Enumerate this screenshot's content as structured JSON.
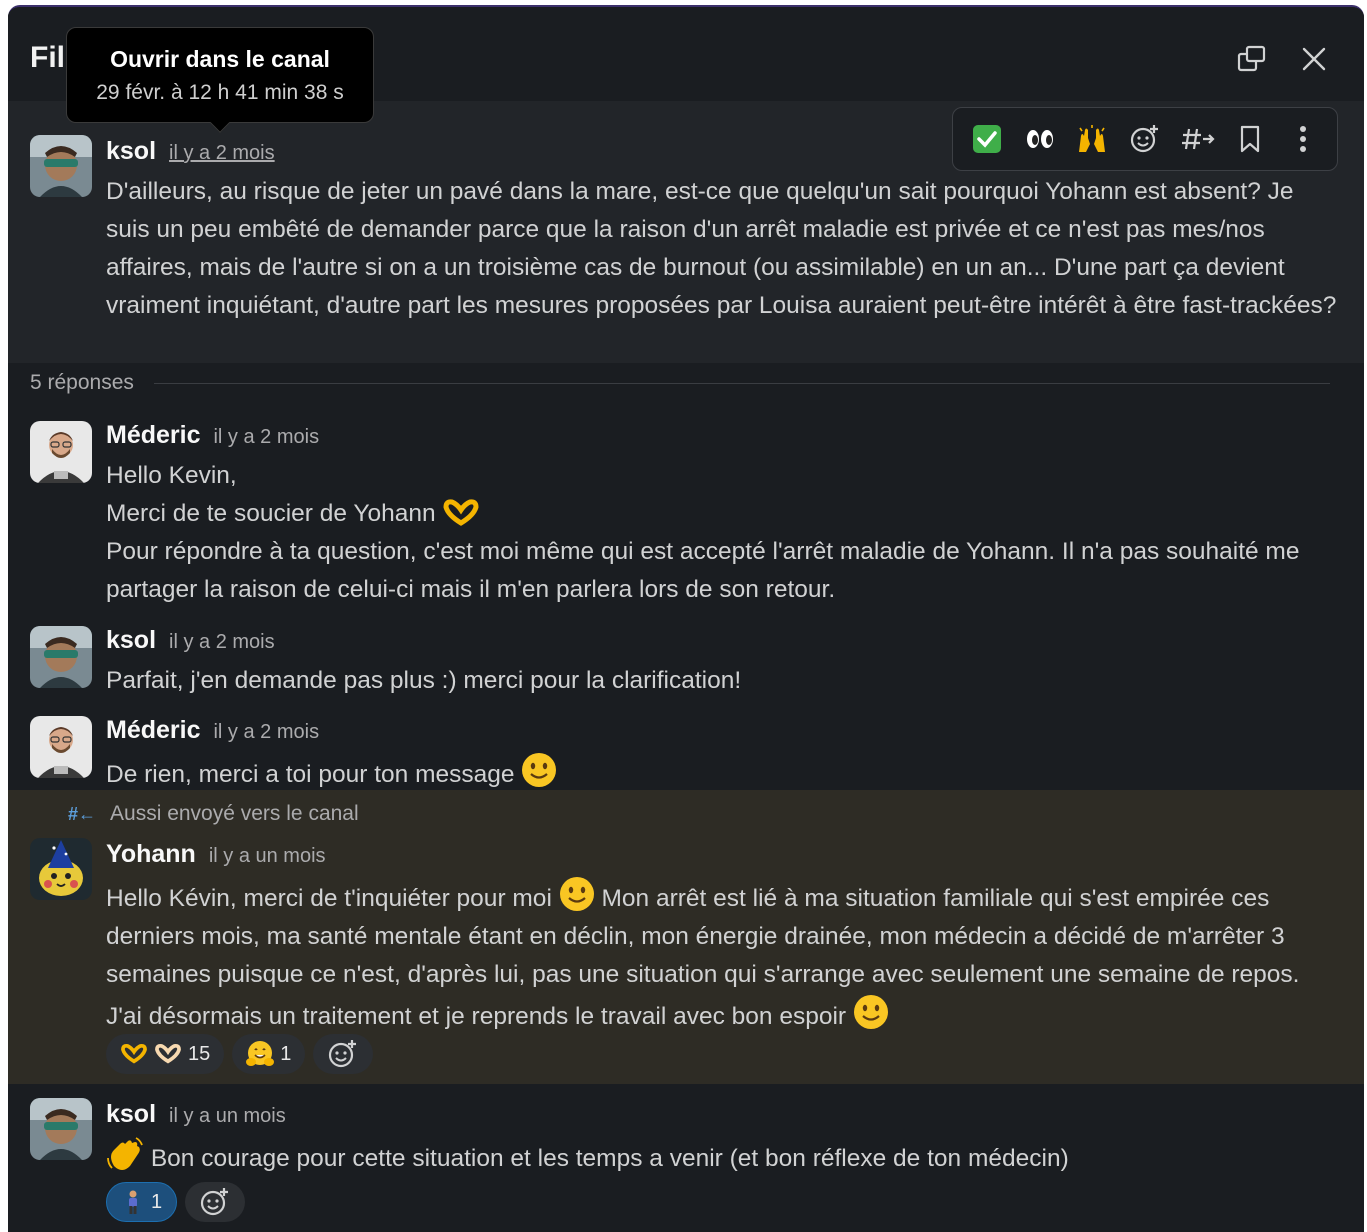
{
  "header": {
    "title": "Fil",
    "tooltip_title": "Ouvrir dans le canal",
    "tooltip_time": "29 févr. à 12 h 41 min 38 s"
  },
  "root": {
    "author": "ksol",
    "time": "il y a 2 mois",
    "text": "D'ailleurs, au risque de jeter un pavé dans la mare, est-ce que quelqu'un sait pourquoi Yohann est absent? Je suis un peu embêté de demander parce que la raison d'un arrêt maladie est privée et ce n'est pas mes/nos affaires, mais de l'autre si on a un troisième cas de burnout (ou assimilable) en un an... D'une part ça devient vraiment inquiétant, d'autre part les mesures proposées par Louisa auraient peut-être intérêt à être fast-trackées?"
  },
  "replies_label": "5 réponses",
  "messages": [
    {
      "author": "Méderic",
      "time": "il y a 2 mois",
      "line1": "Hello Kevin,",
      "line2": "Merci de te soucier de Yohann",
      "line3": "Pour répondre à ta question, c'est moi même qui est accepté l'arrêt maladie de Yohann. Il n'a pas souhaité me partager la raison de celui-ci mais il m'en parlera lors de son retour."
    },
    {
      "author": "ksol",
      "time": "il y a 2 mois",
      "text": "Parfait, j'en demande pas plus :) merci pour la clarification!"
    },
    {
      "author": "Méderic",
      "time": "il y a 2 mois",
      "text": "De rien, merci a toi pour ton message"
    },
    {
      "also_sent": "Aussi envoyé vers le canal",
      "author": "Yohann",
      "time": "il y a un mois",
      "text_a": "Hello Kévin, merci de t'inquiéter pour moi",
      "text_b": "Mon arrêt est lié à ma situation familiale qui s'est empirée ces derniers mois, ma santé mentale étant en déclin, mon énergie drainée, mon médecin a décidé de m'arrêter 3 semaines puisque ce n'est, d'après lui, pas une situation qui s'arrange avec seulement une semaine de repos. J'ai désormais un traitement et je reprends le travail avec bon espoir",
      "reactions": [
        {
          "emoji": "heart-hands",
          "count": "15"
        },
        {
          "emoji": "hugging-face",
          "count": "1"
        }
      ]
    },
    {
      "author": "ksol",
      "time": "il y a un mois",
      "text": "Bon courage pour cette situation et les temps a venir (et bon réflexe de ton médecin)",
      "reactions": [
        {
          "emoji": "person-standing",
          "count": "1"
        }
      ]
    }
  ],
  "colors": {
    "panel_bg": "#1a1d21",
    "hover_bg": "#222529",
    "highlight_bg": "#2e2c25",
    "reaction_active": "#1d4f7c"
  }
}
